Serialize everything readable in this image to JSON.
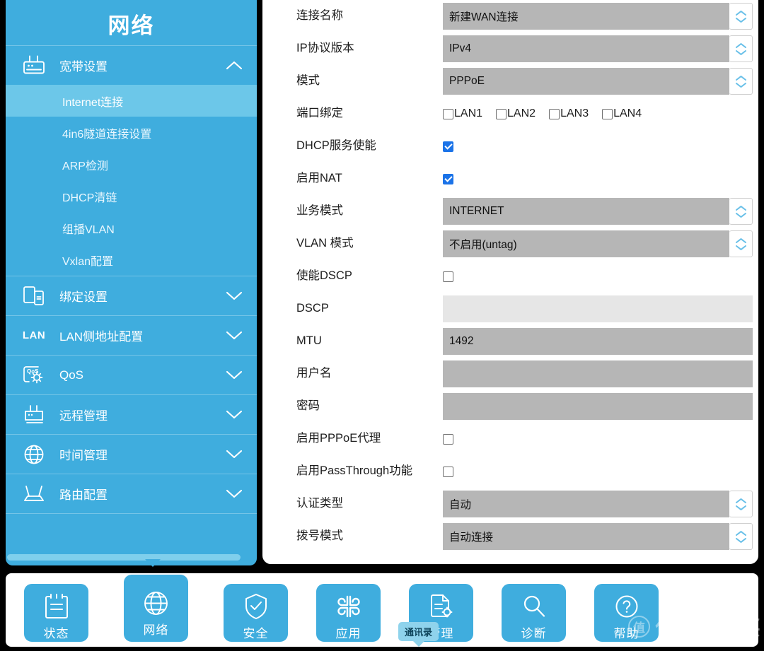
{
  "sidebar": {
    "title": "网络",
    "groups": [
      {
        "label": "宽带设置",
        "icon": "modem-icon",
        "chevron": "chevron-up-icon",
        "expanded": true,
        "items": [
          {
            "label": "Internet连接",
            "active": true
          },
          {
            "label": "4in6隧道连接设置",
            "active": false
          },
          {
            "label": "ARP检测",
            "active": false
          },
          {
            "label": "DHCP清链",
            "active": false
          },
          {
            "label": "组播VLAN",
            "active": false
          },
          {
            "label": "Vxlan配置",
            "active": false
          }
        ]
      },
      {
        "label": "绑定设置",
        "icon": "devices-bind-icon",
        "chevron": "chevron-down-icon",
        "expanded": false,
        "items": []
      },
      {
        "label": "LAN侧地址配置",
        "icon": "lan-text-icon",
        "chevron": "chevron-down-icon",
        "expanded": false,
        "items": []
      },
      {
        "label": "QoS",
        "icon": "qos-gear-icon",
        "chevron": "chevron-down-icon",
        "expanded": false,
        "items": []
      },
      {
        "label": "远程管理",
        "icon": "remote-modem-icon",
        "chevron": "chevron-down-icon",
        "expanded": false,
        "items": []
      },
      {
        "label": "时间管理",
        "icon": "globe-icon",
        "chevron": "chevron-down-icon",
        "expanded": false,
        "items": []
      },
      {
        "label": "路由配置",
        "icon": "router-antenna-icon",
        "chevron": "chevron-down-icon",
        "expanded": false,
        "items": []
      }
    ]
  },
  "form": {
    "rows": [
      {
        "label": "连接名称",
        "type": "select",
        "value": "新建WAN连接"
      },
      {
        "label": "IP协议版本",
        "type": "select",
        "value": "IPv4"
      },
      {
        "label": "模式",
        "type": "select",
        "value": "PPPoE"
      },
      {
        "label": "端口绑定",
        "type": "ports",
        "ports": [
          {
            "label": "LAN1",
            "checked": false
          },
          {
            "label": "LAN2",
            "checked": false
          },
          {
            "label": "LAN3",
            "checked": false
          },
          {
            "label": "LAN4",
            "checked": false
          }
        ]
      },
      {
        "label": "DHCP服务使能",
        "type": "checkbox",
        "checked": true
      },
      {
        "label": "启用NAT",
        "type": "checkbox",
        "checked": true
      },
      {
        "label": "业务模式",
        "type": "select",
        "value": "INTERNET"
      },
      {
        "label": "VLAN 模式",
        "type": "select",
        "value": "不启用(untag)"
      },
      {
        "label": "使能DSCP",
        "type": "checkbox",
        "checked": false
      },
      {
        "label": "DSCP",
        "type": "text",
        "value": "",
        "disabled": true
      },
      {
        "label": "MTU",
        "type": "text",
        "value": "1492",
        "disabled": false
      },
      {
        "label": "用户名",
        "type": "text",
        "value": "",
        "disabled": false
      },
      {
        "label": "密码",
        "type": "text",
        "value": "",
        "disabled": false
      },
      {
        "label": "启用PPPoE代理",
        "type": "checkbox",
        "checked": false
      },
      {
        "label": "启用PassThrough功能",
        "type": "checkbox",
        "checked": false
      },
      {
        "label": "认证类型",
        "type": "select",
        "value": "自动"
      },
      {
        "label": "拨号模式",
        "type": "select",
        "value": "自动连接"
      }
    ]
  },
  "tabbar": {
    "tabs": [
      {
        "label": "状态",
        "icon": "clipboard-status-icon",
        "active": false
      },
      {
        "label": "网络",
        "icon": "globe-network-icon",
        "active": true
      },
      {
        "label": "安全",
        "icon": "shield-check-icon",
        "active": false
      },
      {
        "label": "应用",
        "icon": "apps-grid-icon",
        "active": false
      },
      {
        "label": "管理",
        "icon": "document-gear-icon",
        "active": false
      },
      {
        "label": "诊断",
        "icon": "magnifier-icon",
        "active": false
      },
      {
        "label": "帮助",
        "icon": "question-circle-icon",
        "active": false
      }
    ]
  },
  "tooltip": {
    "text": "通讯录"
  },
  "watermark": {
    "badge": "值",
    "text": "什么值得买"
  },
  "colors": {
    "sidebar_blue": "#3fadde",
    "sidebar_active": "#6cc7e9",
    "field_grey": "#b6b6b6",
    "field_disabled_grey": "#e6e6e6",
    "checkbox_checked": "#1b73e8",
    "stepper_arrow": "#67bfe8"
  }
}
